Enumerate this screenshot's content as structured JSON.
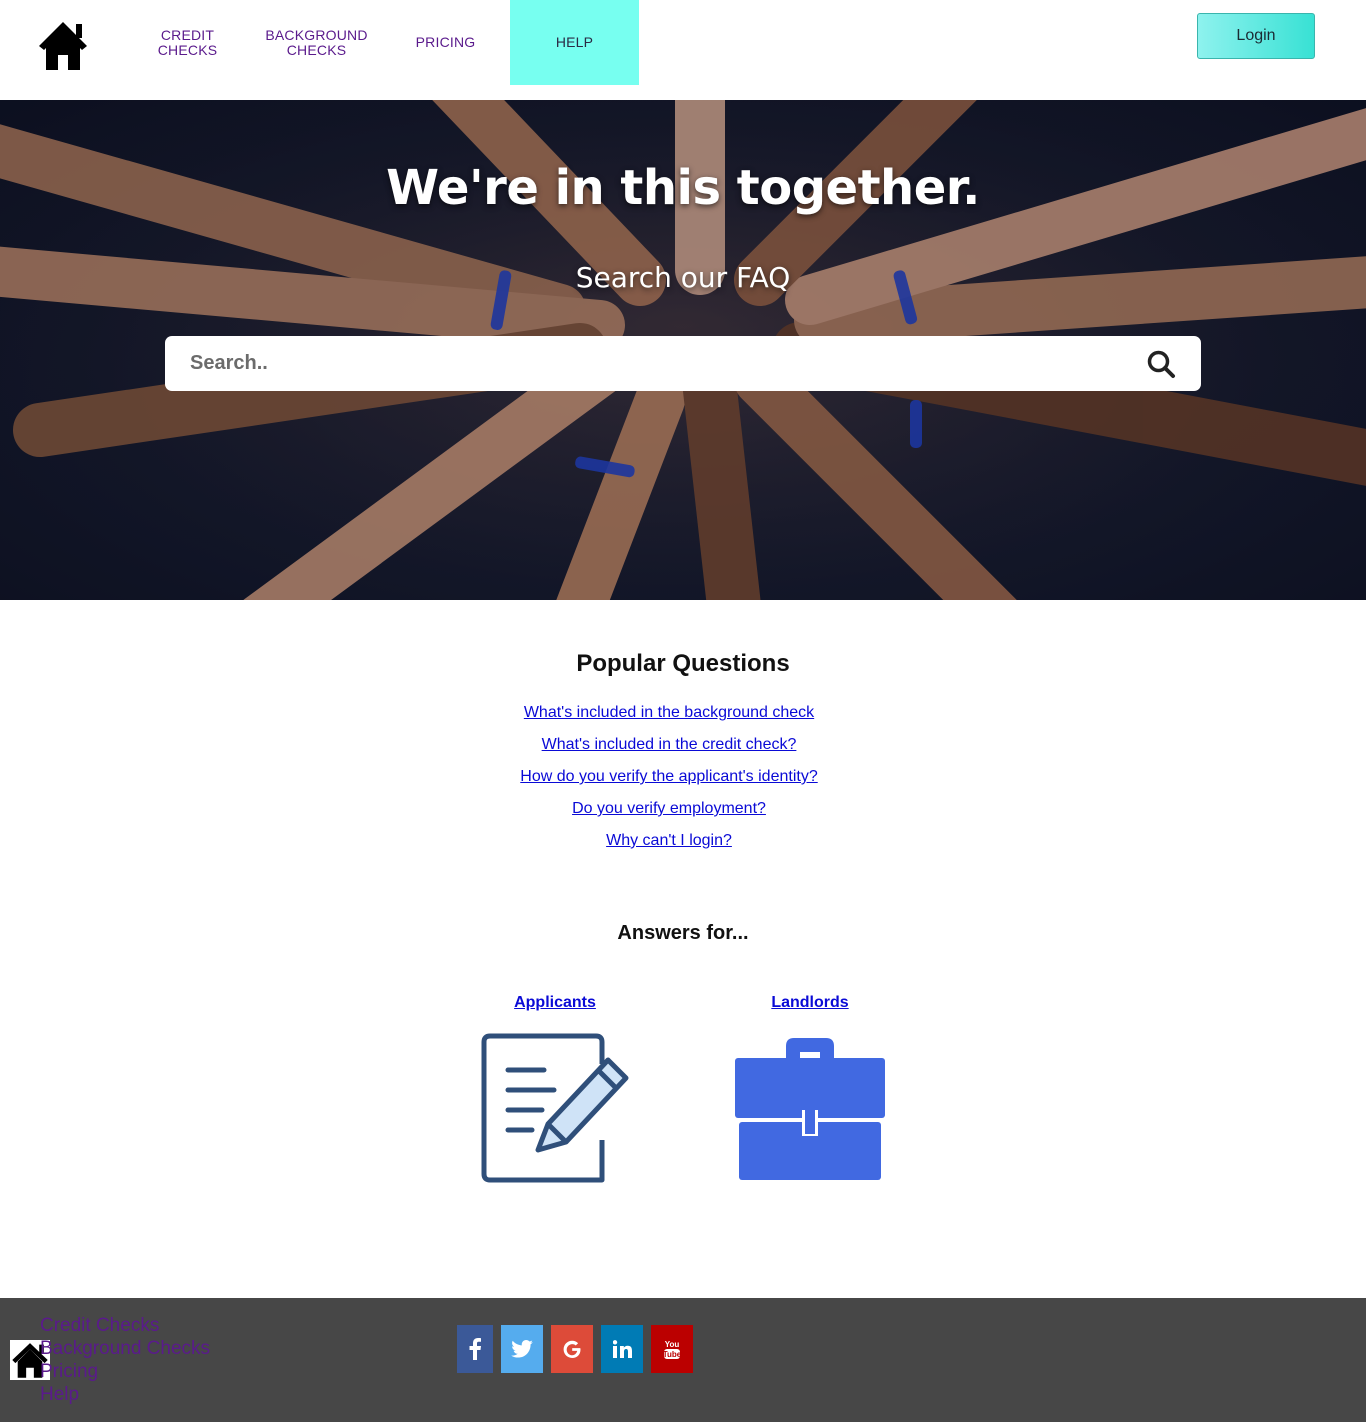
{
  "header": {
    "nav": [
      {
        "line1": "CREDIT",
        "line2": "CHECKS"
      },
      {
        "line1": "BACKGROUND",
        "line2": "CHECKS"
      },
      {
        "line1": "PRICING",
        "line2": ""
      },
      {
        "line1": "HELP",
        "line2": ""
      }
    ],
    "active_nav": "HELP",
    "login_label": "Login"
  },
  "hero": {
    "title": "We're in this together.",
    "subtitle": "Search our FAQ",
    "search_placeholder": "Search.."
  },
  "popular": {
    "title": "Popular Questions",
    "questions": [
      "What's included in the background check",
      "What's included in the credit check?",
      "How do you verify the applicant's identity?",
      "Do you verify employment?",
      "Why can't I login?"
    ]
  },
  "answers": {
    "title": "Answers for...",
    "categories": [
      {
        "label": "Applicants",
        "icon": "edit-document-icon"
      },
      {
        "label": "Landlords",
        "icon": "briefcase-icon"
      }
    ]
  },
  "footer": {
    "links": [
      "Credit Checks",
      "Background Checks",
      "Pricing",
      "Help"
    ],
    "social": [
      {
        "name": "facebook-icon",
        "glyph": "f",
        "color": "#3b5998"
      },
      {
        "name": "twitter-icon",
        "glyph": "t",
        "color": "#55acee"
      },
      {
        "name": "google-icon",
        "glyph": "G",
        "color": "#dd4b39"
      },
      {
        "name": "linkedin-icon",
        "glyph": "in",
        "color": "#007bb5"
      },
      {
        "name": "youtube-icon",
        "glyph": "You Tube",
        "color": "#bb0000"
      }
    ]
  },
  "colors": {
    "nav_text": "#5a1a8c",
    "nav_active_bg": "#77fff0",
    "login_bg": "#38e1d4",
    "link": "#0a0ad6",
    "footer_bg": "#474747",
    "applicant_icon": "#2f4f7a",
    "landlord_icon": "#4169e1"
  }
}
